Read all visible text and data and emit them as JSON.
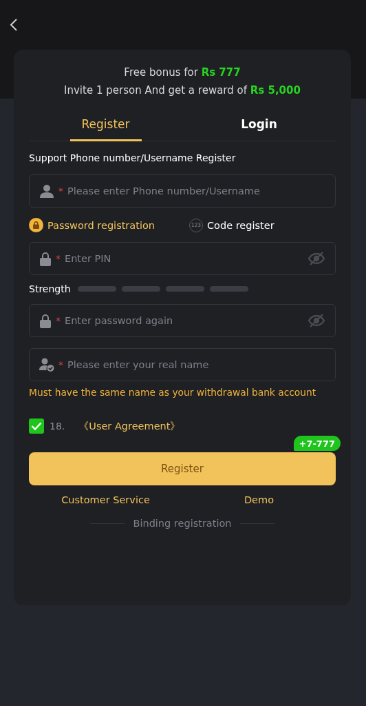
{
  "promo": {
    "lines": [
      "Free bonus for **Rs 777**",
      "Invite 1 person And get a reward of **Rs 5,000**"
    ]
  },
  "tabs": [
    {
      "label": "Register",
      "selected": true
    },
    {
      "label": "Login",
      "selected": false
    }
  ],
  "account_label": "Support Phone number/Username Register",
  "account_field": {
    "kind": "user",
    "marker": "*",
    "placeholder": "Please enter Phone number/Username",
    "secret": false
  },
  "modes": [
    {
      "kind": "lock",
      "label": "Password registration",
      "selected": true
    },
    {
      "kind": "digits",
      "icon_text": "123",
      "label": "Code register",
      "selected": false
    }
  ],
  "password_field": {
    "kind": "lock",
    "marker": "*",
    "placeholder": "Enter PIN",
    "secret": true
  },
  "strength": {
    "label": "Strength"
  },
  "fields": [
    {
      "kind": "lock",
      "marker": "*",
      "placeholder": "Enter password again",
      "secret": true
    },
    {
      "kind": "user-check",
      "marker": "*",
      "placeholder": "Please enter your real name",
      "secret": false
    }
  ],
  "name_note": "Must have the same name as your withdrawal bank account",
  "agreement": {
    "checked": true,
    "age": "18.",
    "link": "《User Agreement》"
  },
  "bonus_badge": "+7-777",
  "submit": "Register",
  "links": [
    "Customer Service",
    "Demo"
  ],
  "divider_text": "Binding registration"
}
